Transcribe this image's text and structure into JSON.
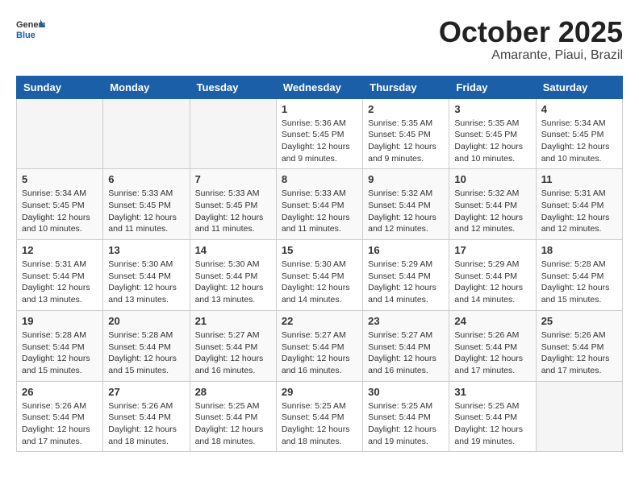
{
  "header": {
    "logo_general": "General",
    "logo_blue": "Blue",
    "month_title": "October 2025",
    "subtitle": "Amarante, Piaui, Brazil"
  },
  "weekdays": [
    "Sunday",
    "Monday",
    "Tuesday",
    "Wednesday",
    "Thursday",
    "Friday",
    "Saturday"
  ],
  "weeks": [
    [
      {
        "day": "",
        "info": ""
      },
      {
        "day": "",
        "info": ""
      },
      {
        "day": "",
        "info": ""
      },
      {
        "day": "1",
        "info": "Sunrise: 5:36 AM\nSunset: 5:45 PM\nDaylight: 12 hours and 9 minutes."
      },
      {
        "day": "2",
        "info": "Sunrise: 5:35 AM\nSunset: 5:45 PM\nDaylight: 12 hours and 9 minutes."
      },
      {
        "day": "3",
        "info": "Sunrise: 5:35 AM\nSunset: 5:45 PM\nDaylight: 12 hours and 10 minutes."
      },
      {
        "day": "4",
        "info": "Sunrise: 5:34 AM\nSunset: 5:45 PM\nDaylight: 12 hours and 10 minutes."
      }
    ],
    [
      {
        "day": "5",
        "info": "Sunrise: 5:34 AM\nSunset: 5:45 PM\nDaylight: 12 hours and 10 minutes."
      },
      {
        "day": "6",
        "info": "Sunrise: 5:33 AM\nSunset: 5:45 PM\nDaylight: 12 hours and 11 minutes."
      },
      {
        "day": "7",
        "info": "Sunrise: 5:33 AM\nSunset: 5:45 PM\nDaylight: 12 hours and 11 minutes."
      },
      {
        "day": "8",
        "info": "Sunrise: 5:33 AM\nSunset: 5:44 PM\nDaylight: 12 hours and 11 minutes."
      },
      {
        "day": "9",
        "info": "Sunrise: 5:32 AM\nSunset: 5:44 PM\nDaylight: 12 hours and 12 minutes."
      },
      {
        "day": "10",
        "info": "Sunrise: 5:32 AM\nSunset: 5:44 PM\nDaylight: 12 hours and 12 minutes."
      },
      {
        "day": "11",
        "info": "Sunrise: 5:31 AM\nSunset: 5:44 PM\nDaylight: 12 hours and 12 minutes."
      }
    ],
    [
      {
        "day": "12",
        "info": "Sunrise: 5:31 AM\nSunset: 5:44 PM\nDaylight: 12 hours and 13 minutes."
      },
      {
        "day": "13",
        "info": "Sunrise: 5:30 AM\nSunset: 5:44 PM\nDaylight: 12 hours and 13 minutes."
      },
      {
        "day": "14",
        "info": "Sunrise: 5:30 AM\nSunset: 5:44 PM\nDaylight: 12 hours and 13 minutes."
      },
      {
        "day": "15",
        "info": "Sunrise: 5:30 AM\nSunset: 5:44 PM\nDaylight: 12 hours and 14 minutes."
      },
      {
        "day": "16",
        "info": "Sunrise: 5:29 AM\nSunset: 5:44 PM\nDaylight: 12 hours and 14 minutes."
      },
      {
        "day": "17",
        "info": "Sunrise: 5:29 AM\nSunset: 5:44 PM\nDaylight: 12 hours and 14 minutes."
      },
      {
        "day": "18",
        "info": "Sunrise: 5:28 AM\nSunset: 5:44 PM\nDaylight: 12 hours and 15 minutes."
      }
    ],
    [
      {
        "day": "19",
        "info": "Sunrise: 5:28 AM\nSunset: 5:44 PM\nDaylight: 12 hours and 15 minutes."
      },
      {
        "day": "20",
        "info": "Sunrise: 5:28 AM\nSunset: 5:44 PM\nDaylight: 12 hours and 15 minutes."
      },
      {
        "day": "21",
        "info": "Sunrise: 5:27 AM\nSunset: 5:44 PM\nDaylight: 12 hours and 16 minutes."
      },
      {
        "day": "22",
        "info": "Sunrise: 5:27 AM\nSunset: 5:44 PM\nDaylight: 12 hours and 16 minutes."
      },
      {
        "day": "23",
        "info": "Sunrise: 5:27 AM\nSunset: 5:44 PM\nDaylight: 12 hours and 16 minutes."
      },
      {
        "day": "24",
        "info": "Sunrise: 5:26 AM\nSunset: 5:44 PM\nDaylight: 12 hours and 17 minutes."
      },
      {
        "day": "25",
        "info": "Sunrise: 5:26 AM\nSunset: 5:44 PM\nDaylight: 12 hours and 17 minutes."
      }
    ],
    [
      {
        "day": "26",
        "info": "Sunrise: 5:26 AM\nSunset: 5:44 PM\nDaylight: 12 hours and 17 minutes."
      },
      {
        "day": "27",
        "info": "Sunrise: 5:26 AM\nSunset: 5:44 PM\nDaylight: 12 hours and 18 minutes."
      },
      {
        "day": "28",
        "info": "Sunrise: 5:25 AM\nSunset: 5:44 PM\nDaylight: 12 hours and 18 minutes."
      },
      {
        "day": "29",
        "info": "Sunrise: 5:25 AM\nSunset: 5:44 PM\nDaylight: 12 hours and 18 minutes."
      },
      {
        "day": "30",
        "info": "Sunrise: 5:25 AM\nSunset: 5:44 PM\nDaylight: 12 hours and 19 minutes."
      },
      {
        "day": "31",
        "info": "Sunrise: 5:25 AM\nSunset: 5:44 PM\nDaylight: 12 hours and 19 minutes."
      },
      {
        "day": "",
        "info": ""
      }
    ]
  ]
}
